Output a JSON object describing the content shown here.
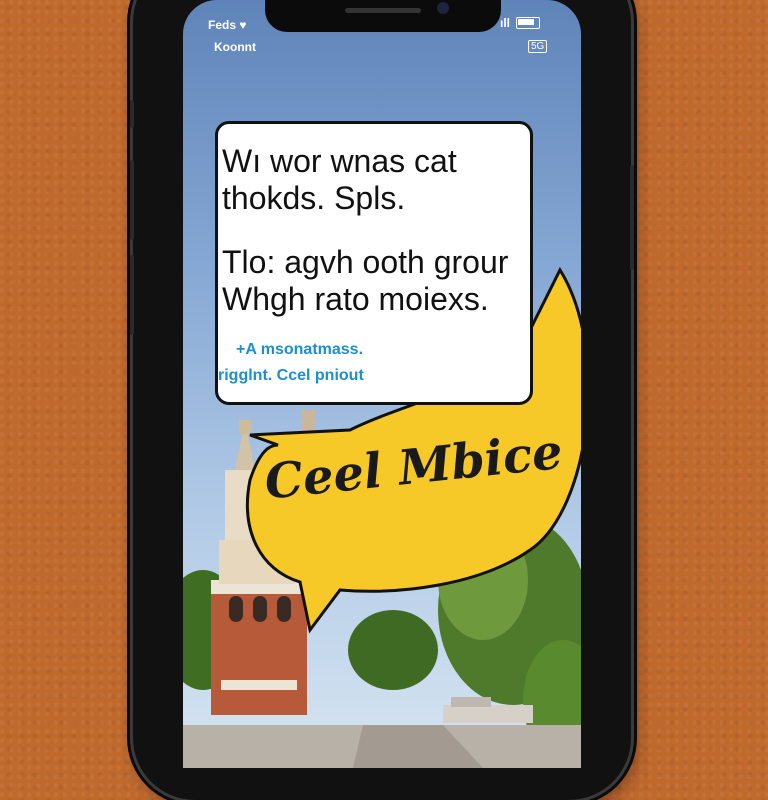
{
  "status_bar": {
    "carrier": "Feds",
    "heart": "♥",
    "subtitle": "Koonnt",
    "signal_label": "ıll",
    "badge": "5G"
  },
  "message_card": {
    "line1": "Wı wor wnas cat",
    "line2": "thokds. Spls.",
    "line3": "Tlo: agvh ooth grour",
    "line4": "Whgh rato moiexs.",
    "link1": "+A msonatmass.",
    "link2": "rigglnt. Ccel pniout"
  },
  "speech_bubble": {
    "text": "Ceel Mbice"
  },
  "colors": {
    "background": "#c0692d",
    "bubble": "#f6c928",
    "link": "#1a8fd1"
  },
  "icons": [
    "heart-icon",
    "signal-icon",
    "battery-icon"
  ]
}
